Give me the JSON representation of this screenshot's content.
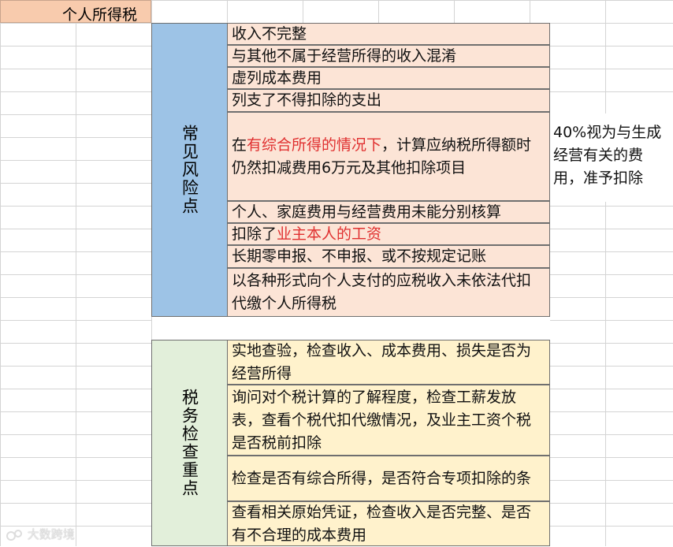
{
  "title": "个人所得税",
  "risk": {
    "label": "常见风险点",
    "items": [
      {
        "text": "收入不完整"
      },
      {
        "text": "与其他不属于经营所得的收入混淆"
      },
      {
        "text": "虚列成本费用"
      },
      {
        "text": "列支了不得扣除的支出"
      },
      {
        "text_pre": "在",
        "text_red": "有综合所得的情况下",
        "text_post": "，计算应纳税所得额时仍然扣减费用6万元及其他扣除项目"
      },
      {
        "text": "个人、家庭费用与经营费用未能分别核算"
      },
      {
        "text_pre": "扣除了",
        "text_red": "业主本人的工资",
        "text_post": ""
      },
      {
        "text": "长期零申报、不申报、或不按规定记账"
      },
      {
        "text": "以各种形式向个人支付的应税收入未依法代扣代缴个人所得税"
      }
    ],
    "note": "40%视为与生成经营有关的费用，准予扣除"
  },
  "check": {
    "label": "税务检查重点",
    "items": [
      {
        "text": "实地查验，检查收入、成本费用、损失是否为经营所得"
      },
      {
        "text": "询问对个税计算的了解程度，检查工薪发放表，查看个税代扣代缴情况，及业主工资个税是否税前扣除"
      },
      {
        "text": "检查是否有综合所得，是否符合专项扣除的条"
      },
      {
        "text": "查看相关原始凭证，检查收入是否完整、是否有不合理的成本费用"
      }
    ]
  },
  "watermark": "大数跨境",
  "colors": {
    "risk_label": "#9dc3e6",
    "risk_bg": "#fce4d6",
    "check_label": "#e2efda",
    "check_bg": "#fff2cc",
    "title_bg": "#f8cbad",
    "highlight": "#e03030"
  }
}
